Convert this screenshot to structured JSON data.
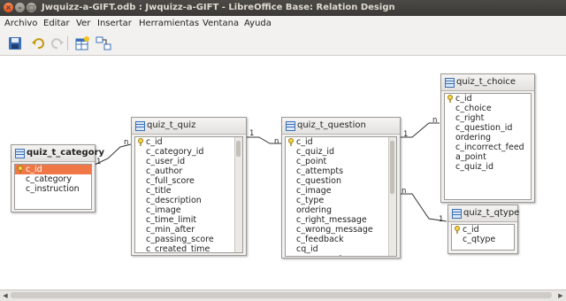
{
  "window": {
    "title": "Jwquizz-a-GIFT.odb : Jwquizz-a-GIFT - LibreOffice Base: Relation Design",
    "controls": {
      "close": "×",
      "minimize": "–",
      "maximize": "□"
    }
  },
  "menu": [
    "Archivo",
    "Editar",
    "Ver",
    "Insertar",
    "Herramientas",
    "Ventana",
    "Ayuda"
  ],
  "toolbar": [
    "save-icon",
    "undo-icon",
    "redo-icon",
    "new-table-icon",
    "new-relation-icon"
  ],
  "tables": {
    "category": {
      "name": "quiz_t_category",
      "fields": [
        "c_id",
        "c_category",
        "c_instruction"
      ],
      "selected": "c_id"
    },
    "quiz": {
      "name": "quiz_t_quiz",
      "fields": [
        "c_id",
        "c_category_id",
        "c_user_id",
        "c_author",
        "c_full_score",
        "c_title",
        "c_description",
        "c_image",
        "c_time_limit",
        "c_min_after",
        "c_passing_score",
        "c_created_time"
      ]
    },
    "question": {
      "name": "quiz_t_question",
      "fields": [
        "c_id",
        "c_quiz_id",
        "c_point",
        "c_attempts",
        "c_question",
        "c_image",
        "c_type",
        "ordering",
        "c_right_message",
        "c_wrong_message",
        "c_feedback",
        "cq_id",
        "c_ques_cat"
      ]
    },
    "choice": {
      "name": "quiz_t_choice",
      "fields": [
        "c_id",
        "c_choice",
        "c_right",
        "c_question_id",
        "ordering",
        "c_incorrect_feed",
        "a_point",
        "c_quiz_id"
      ]
    },
    "qtype": {
      "name": "quiz_t_qtype",
      "fields": [
        "c_id",
        "c_qtype"
      ]
    }
  },
  "relations": {
    "one": "1",
    "many": "n"
  },
  "colors": {
    "selection": "#f07746",
    "canvas": "#ffffff",
    "titlebar": "#3b3a36"
  }
}
